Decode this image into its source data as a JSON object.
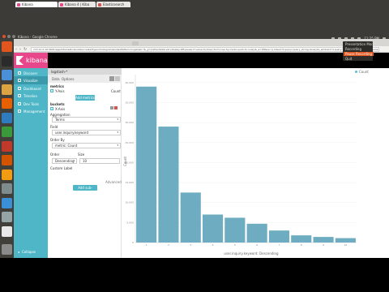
{
  "os": {
    "window_title": "Kibana - Google Chrome",
    "clock": "11:25 PM",
    "launcher_icons": [
      "ubuntu-icon",
      "terminal-icon",
      "chrome-icon",
      "files-icon",
      "firefox-icon",
      "writer-icon",
      "calc-icon",
      "impress-icon",
      "software-center-icon",
      "amazon-icon",
      "settings-icon",
      "chromium-icon",
      "system-icon",
      "text-editor-icon"
    ],
    "colors": {
      "panel": "#3c3b37",
      "launcher": "#403f3a",
      "accent": "#e2561e"
    }
  },
  "browser": {
    "tabs": [
      {
        "label": "Kibana",
        "active": true,
        "favicon_color": "#e8488b"
      },
      {
        "label": "Kibana 4 | Kiba",
        "active": false,
        "favicon_color": "#e8488b"
      },
      {
        "label": "Elasticsearch",
        "active": false,
        "favicon_color": "#d9534f"
      }
    ],
    "url": "172.21.0.10:5601/app/kibana#/visualize/create?type=histogram&indexPattern=logstash-*&_g=(refreshInterval:(display:Off,pause:!f,value:0),time:(from:now-5y,mode:quick,to:now))&_a=(filters:!(),linked:!f,query:(query_string:(analyze_wildcard:!t,query:'*')),vis:(aggs:!((id:'1',params:(),schema:metric,type:count),(id:'2',params:(field:response,order:desc,orderBy:'1',size:10),schema:segment,type:terms)),listeners:(),params:(addLegend:!t,addTimeMarker:!f,addTooltip:!t,defaultYExtents:!f,mode:stacked,scale:linear,setYExtents:!f,shareYAxis:!t,times:!(),yAxis:()),title:'New Visualization',type:histogram))"
  },
  "kibana": {
    "brand": "kibana",
    "nav": [
      {
        "label": "Discover",
        "icon": "compass-icon",
        "active": false
      },
      {
        "label": "Visualize",
        "icon": "bar-chart-icon",
        "active": true
      },
      {
        "label": "Dashboard",
        "icon": "dashboard-icon",
        "active": false
      },
      {
        "label": "Timelion",
        "icon": "timelion-icon",
        "active": false
      },
      {
        "label": "Dev Tools",
        "icon": "wrench-icon",
        "active": false
      },
      {
        "label": "Management",
        "icon": "gear-icon",
        "active": false
      }
    ],
    "collapse_label": "Collapse",
    "colors": {
      "sidebar": "#4fb6c7",
      "logo_bg": "#e8488b",
      "bar": "#6eadc1"
    }
  },
  "editor": {
    "index_pattern": "logstash-*",
    "tabs": [
      "Data",
      "Options"
    ],
    "metrics_title": "metrics",
    "y_axis_label": "Y-Axis",
    "count_label": "Count",
    "add_metrics_label": "Add metrics",
    "buckets_title": "buckets",
    "x_axis_label": "X-Axis",
    "aggregation_label": "Aggregation",
    "aggregation_value": "Terms",
    "field_label": "Field",
    "field_value": "user.inquiry.keyword",
    "order_by_label": "Order By",
    "order_by_value": "metric: Count",
    "order_label": "Order",
    "order_value": "Descending",
    "size_label": "Size",
    "size_value": "10",
    "custom_label_label": "Custom Label",
    "advanced_label": "Advanced",
    "add_sub_buckets_label": "Add sub-buckets"
  },
  "legend_toggle_label": "Count",
  "popup": {
    "items": [
      {
        "label": "Presentation Mode",
        "highlighted": false
      },
      {
        "label": "Recording",
        "highlighted": false
      },
      {
        "label": "Pause Recording",
        "highlighted": true
      },
      {
        "label": "Quit",
        "highlighted": false
      }
    ]
  },
  "chart_data": {
    "type": "bar",
    "categories": [
      "1",
      "2",
      "3",
      "4",
      "5",
      "6",
      "7",
      "8",
      "9",
      "10"
    ],
    "values": [
      39000,
      29000,
      12500,
      7000,
      6200,
      4700,
      3000,
      1800,
      1400,
      1100
    ],
    "ylim": [
      0,
      42000
    ],
    "yticks": [
      0,
      5000,
      10000,
      15000,
      20000,
      25000,
      30000,
      35000,
      40000
    ],
    "ylabel": "Count",
    "xlabel": "user.inquiry.keyword: Descending",
    "grid": true,
    "legend": "top-right",
    "color": "#6eadc1"
  }
}
